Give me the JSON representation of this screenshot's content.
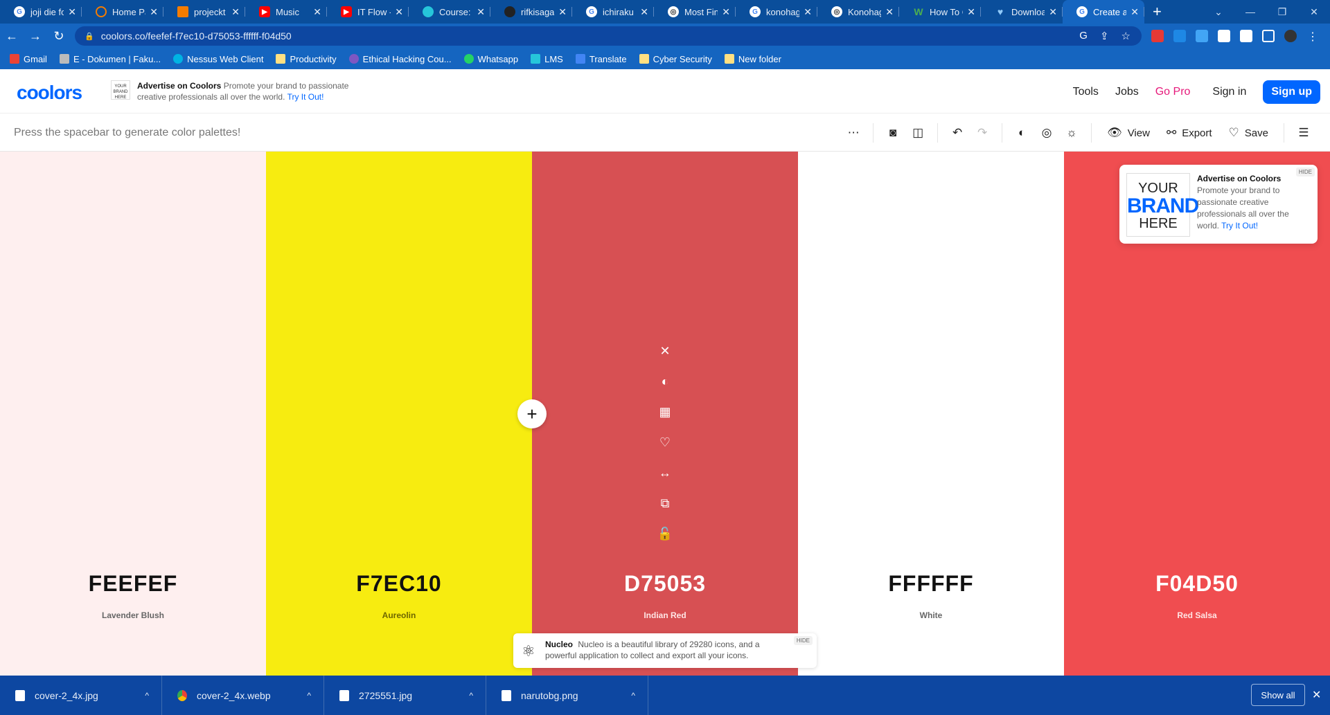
{
  "browser": {
    "tabs": [
      {
        "title": "joji die fo",
        "icon": "google-icon"
      },
      {
        "title": "Home Pag",
        "icon": "loading-icon"
      },
      {
        "title": "projeckt k",
        "icon": "book-icon"
      },
      {
        "title": "Music",
        "icon": "youtube-icon"
      },
      {
        "title": "IT Flow - Y",
        "icon": "youtube-icon"
      },
      {
        "title": "Course: IF",
        "icon": "course-icon"
      },
      {
        "title": "rifkisagas",
        "icon": "github-icon"
      },
      {
        "title": "ichiraku r",
        "icon": "google-icon"
      },
      {
        "title": "Most Fine",
        "icon": "globe-icon"
      },
      {
        "title": "konohaga",
        "icon": "google-icon"
      },
      {
        "title": "Konohaga",
        "icon": "globe-icon"
      },
      {
        "title": "How To C",
        "icon": "w-icon"
      },
      {
        "title": "Downloac",
        "icon": "heart-icon"
      },
      {
        "title": "Create a F",
        "icon": "google-icon",
        "active": true
      }
    ],
    "url": "coolors.co/feefef-f7ec10-d75053-ffffff-f04d50",
    "bookmarks": [
      "Gmail",
      "E - Dokumen | Faku...",
      "Nessus Web Client",
      "Productivity",
      "Ethical Hacking Cou...",
      "Whatsapp",
      "LMS",
      "Translate",
      "Cyber Security",
      "New folder"
    ]
  },
  "header": {
    "logo": "coolors",
    "ad_title": "Advertise on Coolors",
    "ad_text": "Promote your brand to passionate creative professionals all over the world.",
    "ad_link": "Try It Out!",
    "ad_thumb": "YOUR BRAND HERE",
    "tools": "Tools",
    "jobs": "Jobs",
    "gopro": "Go Pro",
    "signin": "Sign in",
    "signup": "Sign up"
  },
  "toolbar": {
    "hint": "Press the spacebar to generate color palettes!",
    "view": "View",
    "export": "Export",
    "save": "Save"
  },
  "palette": [
    {
      "hex": "FEEFEF",
      "name": "Lavender Blush",
      "color": "#feefef"
    },
    {
      "hex": "F7EC10",
      "name": "Aureolin",
      "color": "#f7ec10"
    },
    {
      "hex": "D75053",
      "name": "Indian Red",
      "color": "#d75053"
    },
    {
      "hex": "FFFFFF",
      "name": "White",
      "color": "#ffffff"
    },
    {
      "hex": "F04D50",
      "name": "Red Salsa",
      "color": "#f04d50"
    }
  ],
  "ad_card": {
    "thumb_your": "YOUR",
    "thumb_brand": "BRAND",
    "thumb_here": "HERE",
    "title": "Advertise on Coolors",
    "text": "Promote your brand to passionate creative professionals all over the world.",
    "link": "Try It Out!",
    "hide": "HIDE"
  },
  "nucleo": {
    "title": "Nucleo",
    "text": "Nucleo is a beautiful library of 29280 icons, and a powerful application to collect and export all your icons.",
    "hide": "HIDE"
  },
  "downloads": {
    "items": [
      "cover-2_4x.jpg",
      "cover-2_4x.webp",
      "2725551.jpg",
      "narutobg.png"
    ],
    "show_all": "Show all"
  }
}
